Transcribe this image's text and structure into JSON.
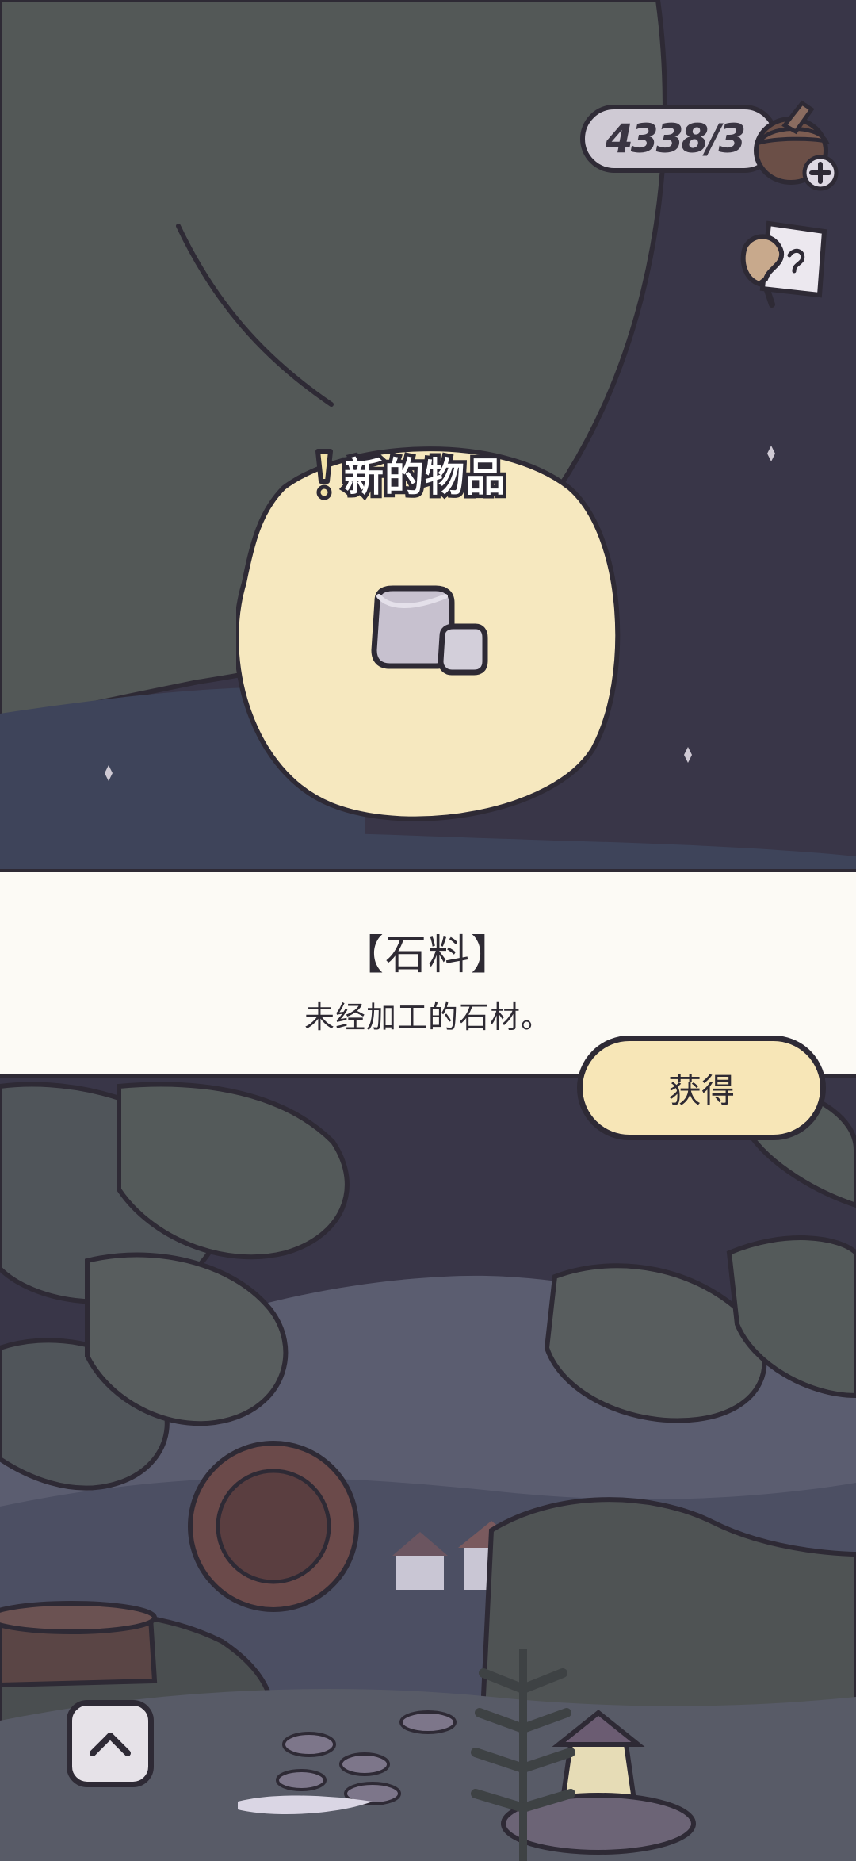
{
  "hud": {
    "currency_amount": "4338/3",
    "currency_icon": "acorn-plus-icon",
    "notes_icon": "notes-icon"
  },
  "new_item": {
    "badge_label": "新的物品",
    "icon": "stone-cubes-icon",
    "name": "【石料】",
    "description": "未经加工的石材。",
    "obtain_label": "获得"
  },
  "controls": {
    "expand_icon": "chevron-up-icon"
  },
  "colors": {
    "banner_bg": "#fcfaf5",
    "button_bg": "#f7e6b7",
    "outline": "#2e2a35",
    "night_sky": "#393648",
    "leaf": "#535857"
  }
}
